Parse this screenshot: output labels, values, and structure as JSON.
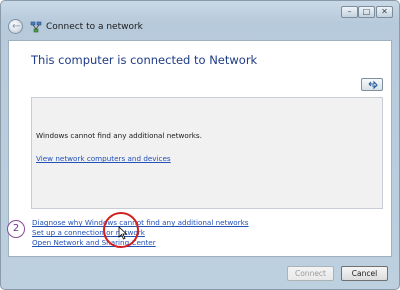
{
  "window": {
    "title": "Connect to a network",
    "controls": [
      "minimize",
      "maximize",
      "close"
    ]
  },
  "heading": "This computer is connected to Network",
  "network_list": {
    "message": "Windows cannot find any additional networks.",
    "view_link": "View network computers and devices"
  },
  "links": {
    "diagnose": "Diagnose why Windows cannot find any additional networks",
    "setup": "Set up a connection or network",
    "sharing": "Open Network and Sharing Center"
  },
  "buttons": {
    "connect": "Connect",
    "cancel": "Cancel"
  },
  "annotation": {
    "step": "2"
  },
  "icons": {
    "back": "back-arrow-icon",
    "network": "network-icon",
    "refresh": "refresh-icon"
  },
  "colors": {
    "link": "#2251b8",
    "heading": "#1e3b85",
    "highlight": "#d21f1f",
    "step_badge": "#8a4aa0"
  }
}
